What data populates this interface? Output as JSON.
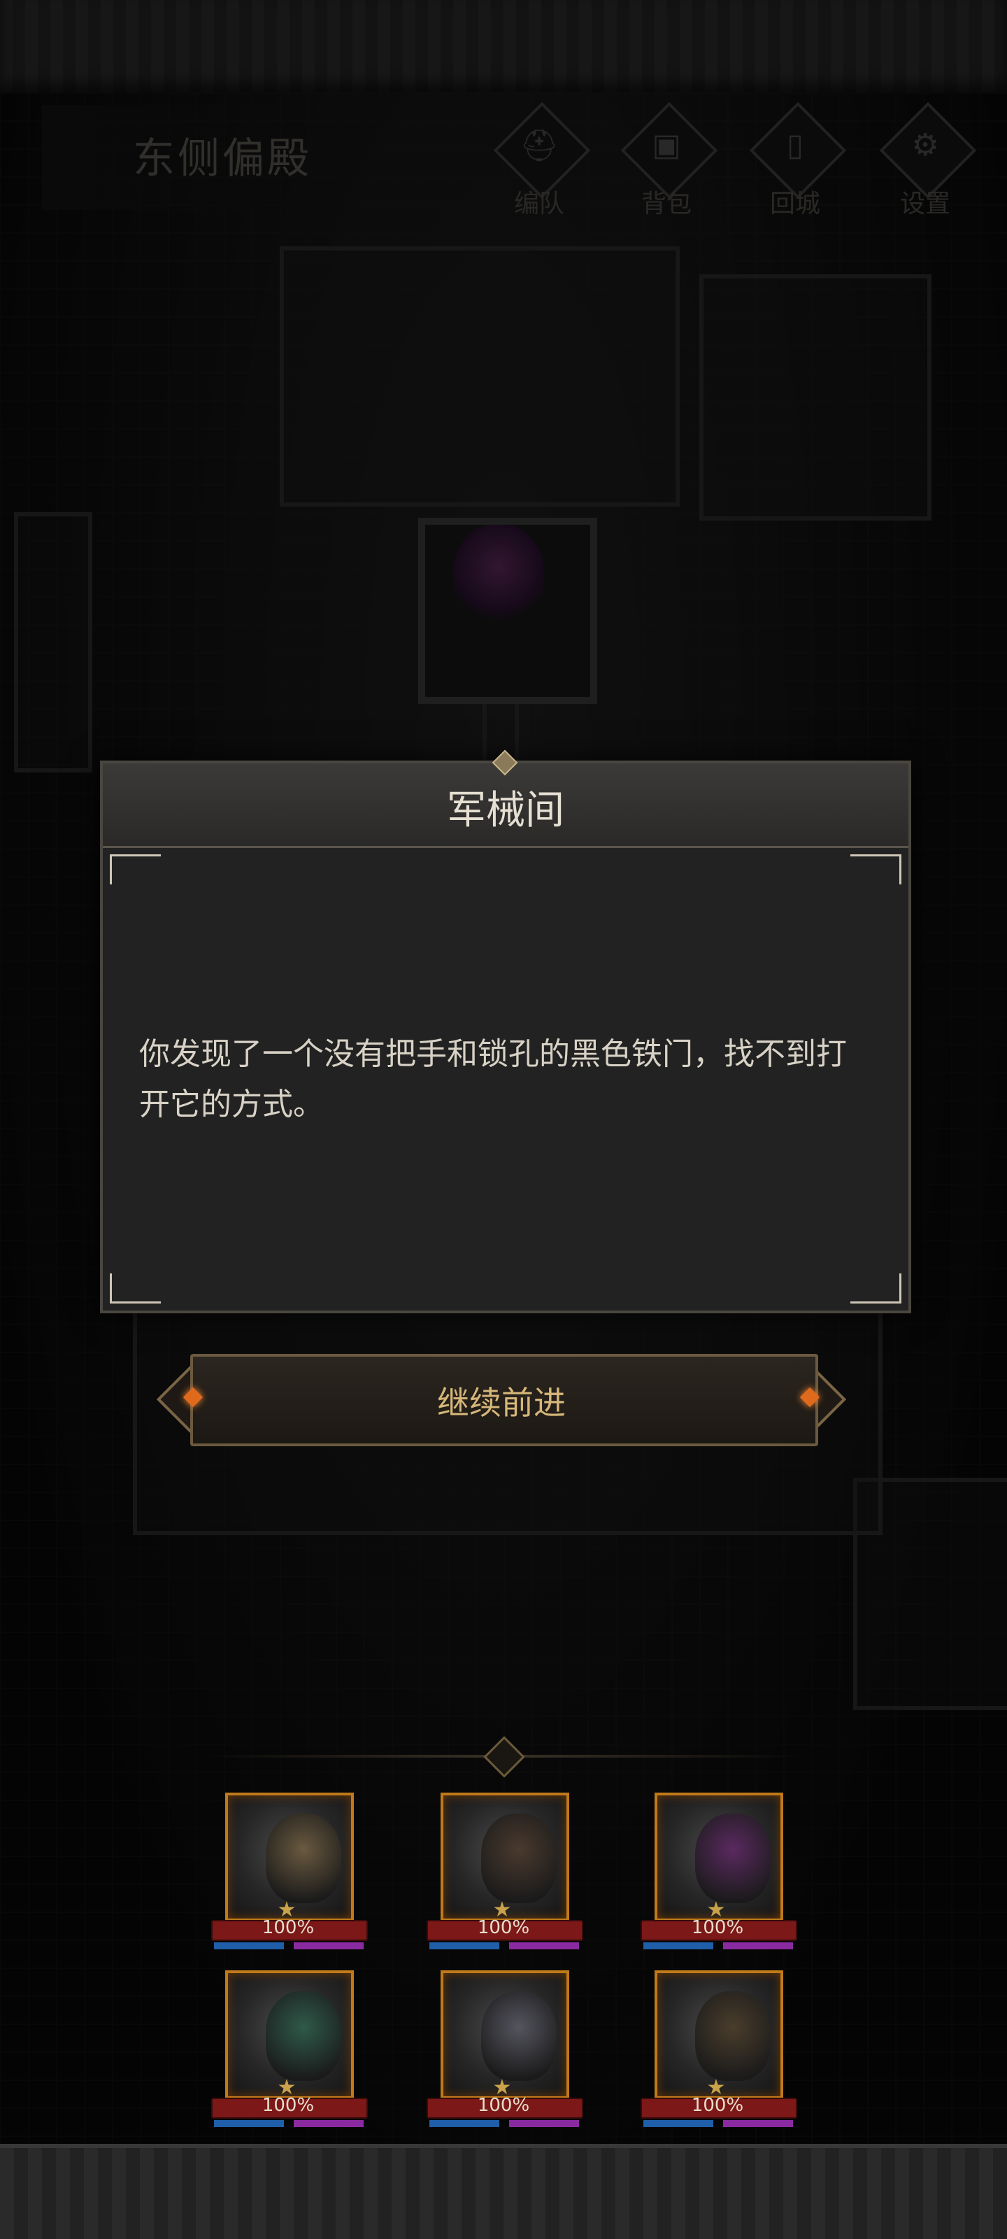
{
  "header": {
    "area_title": "东侧偏殿",
    "buttons": [
      {
        "label": "编队",
        "icon": "helmet-icon"
      },
      {
        "label": "背包",
        "icon": "backpack-icon"
      },
      {
        "label": "回城",
        "icon": "door-icon"
      },
      {
        "label": "设置",
        "icon": "gear-icon"
      }
    ]
  },
  "dialog": {
    "title": "军械间",
    "body": "你发现了一个没有把手和锁孔的黑色铁门，找不到打开它的方式。"
  },
  "continue_button": {
    "label": "继续前进"
  },
  "party": {
    "heroes": [
      {
        "hp": "100%",
        "face_color": "#6a5a40"
      },
      {
        "hp": "100%",
        "face_color": "#4a3a2e"
      },
      {
        "hp": "100%",
        "face_color": "#5a2a60"
      },
      {
        "hp": "100%",
        "face_color": "#2f5a4a"
      },
      {
        "hp": "100%",
        "face_color": "#55555f"
      },
      {
        "hp": "100%",
        "face_color": "#4a3d2c"
      }
    ]
  },
  "colors": {
    "hp": "#7c1818",
    "mp": "#1f5ea8",
    "sp": "#8a2aa0",
    "accent_gold": "#c07a1a",
    "button_text": "#d6b77a"
  }
}
